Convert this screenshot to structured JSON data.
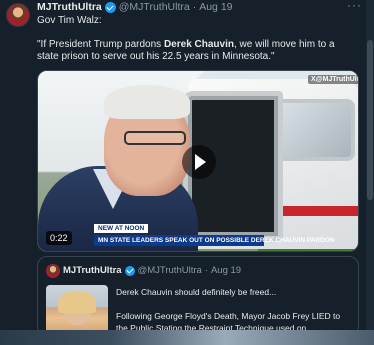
{
  "post": {
    "author_name": "MJTruthUltra",
    "handle": "@MJTruthUltra",
    "separator": "·",
    "date": "Aug 19",
    "more_label": "···",
    "line1": "Gov Tim Walz:",
    "quote_prefix": "\"If President Trump pardons ",
    "quote_bold": "Derek Chauvin",
    "quote_suffix": ", we will move him to a state prison to serve out his 22.5 years in Minnesota.\""
  },
  "video": {
    "watermark": "X@MJTruthUltra",
    "lower_third_label": "NEW AT NOON",
    "lower_third_text": "MN STATE LEADERS SPEAK OUT ON POSSIBLE DEREK CHAUVIN PARDON",
    "duration": "0:22"
  },
  "quoted_post": {
    "author_name": "MJTruthUltra",
    "handle": "@MJTruthUltra",
    "separator": "·",
    "date": "Aug 19",
    "line1": "Derek Chauvin should definitely be freed...",
    "line2": "Following George Floyd's Death, Mayor Jacob Frey LIED to the Public Stating the Restraint Technique used on"
  },
  "colors": {
    "background": "#15202b",
    "verified": "#1d9bf0",
    "muted_text": "#8b98a5"
  }
}
